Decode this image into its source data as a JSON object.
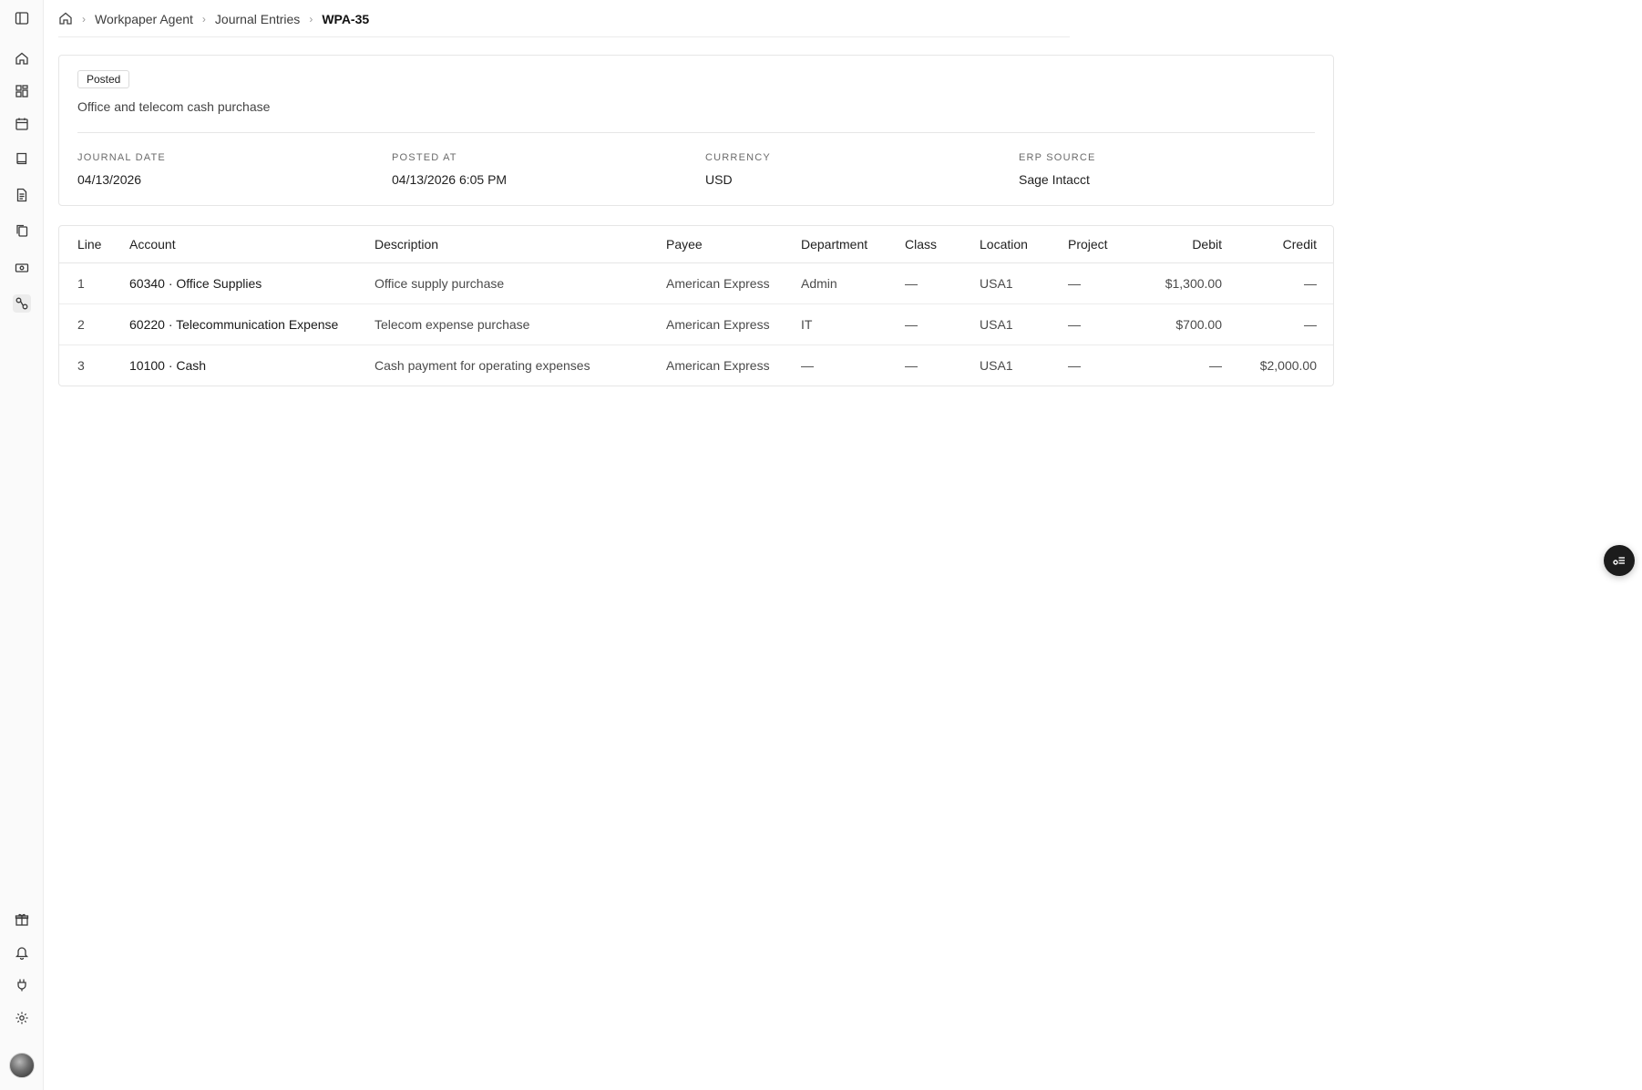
{
  "breadcrumb": {
    "items": [
      "Workpaper Agent",
      "Journal Entries"
    ],
    "current": "WPA-35",
    "separator": "›"
  },
  "entry": {
    "status": "Posted",
    "memo": "Office and telecom cash purchase",
    "fields": [
      {
        "label": "JOURNAL DATE",
        "value": "04/13/2026"
      },
      {
        "label": "POSTED AT",
        "value": "04/13/2026 6:05 PM"
      },
      {
        "label": "CURRENCY",
        "value": "USD"
      },
      {
        "label": "ERP SOURCE",
        "value": "Sage Intacct"
      }
    ]
  },
  "table": {
    "headers": [
      "Line",
      "Account",
      "Description",
      "Payee",
      "Department",
      "Class",
      "Location",
      "Project",
      "Debit",
      "Credit"
    ],
    "rows": [
      [
        "1",
        "60340 · Office Supplies",
        "Office supply purchase",
        "American Express",
        "Admin",
        "—",
        "USA1",
        "—",
        "$1,300.00",
        "—"
      ],
      [
        "2",
        "60220 · Telecommunication Expense",
        "Telecom expense purchase",
        "American Express",
        "IT",
        "—",
        "USA1",
        "—",
        "$700.00",
        "—"
      ],
      [
        "3",
        "10100 · Cash",
        "Cash payment for operating expenses",
        "American Express",
        "—",
        "—",
        "USA1",
        "—",
        "—",
        "$2,000.00"
      ]
    ]
  },
  "sidebar": {
    "icons": [
      "sidebar-toggle-icon",
      "home-icon",
      "dashboard-icon",
      "calendar-icon",
      "book-icon",
      "document-icon",
      "copy-icon",
      "cash-icon",
      "workflow-icon",
      "gift-icon",
      "bell-icon",
      "plug-icon",
      "gear-icon"
    ]
  },
  "colors": {
    "accent": "#1c1c1c",
    "border": "#e6e6e6",
    "sidebar_bg": "#fafafa"
  }
}
